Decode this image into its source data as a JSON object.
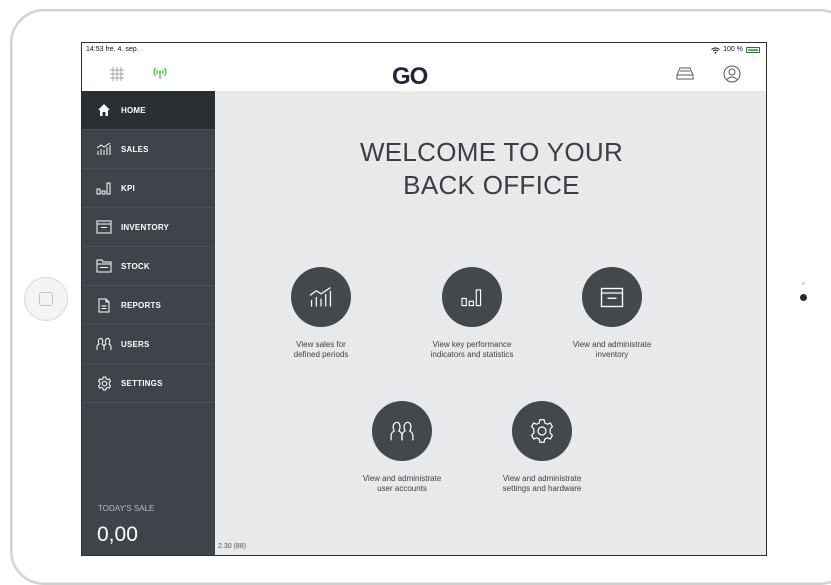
{
  "statusbar": {
    "time": "14:53",
    "date": "fre. 4. sep.",
    "battery": "100 %"
  },
  "header": {
    "logo": "GO"
  },
  "sidebar": {
    "items": [
      {
        "label": "HOME",
        "icon": "home-icon",
        "active": true
      },
      {
        "label": "SALES",
        "icon": "sales-chart-icon",
        "active": false
      },
      {
        "label": "KPI",
        "icon": "kpi-bars-icon",
        "active": false
      },
      {
        "label": "INVENTORY",
        "icon": "inventory-box-icon",
        "active": false
      },
      {
        "label": "STOCK",
        "icon": "stock-folder-icon",
        "active": false
      },
      {
        "label": "REPORTS",
        "icon": "reports-document-icon",
        "active": false
      },
      {
        "label": "USERS",
        "icon": "users-icon",
        "active": false
      },
      {
        "label": "SETTINGS",
        "icon": "settings-gear-icon",
        "active": false
      }
    ],
    "today_label": "TODAY'S SALE",
    "today_value": "0,00"
  },
  "main": {
    "welcome_line1": "WELCOME TO YOUR",
    "welcome_line2": "BACK OFFICE",
    "tiles": [
      {
        "line1": "View sales for",
        "line2": "defined periods",
        "icon": "sales-chart-icon"
      },
      {
        "line1": "View key performance",
        "line2": "indicators and statistics",
        "icon": "kpi-bars-icon"
      },
      {
        "line1": "View and administrate",
        "line2": "inventory",
        "icon": "inventory-box-icon"
      },
      {
        "line1": "View and administrate",
        "line2": "user accounts",
        "icon": "users-icon"
      },
      {
        "line1": "View and administrate",
        "line2": "settings and hardware",
        "icon": "settings-gear-icon"
      }
    ],
    "version": "2.30 (88)"
  },
  "colors": {
    "sidebar": "#3e4449",
    "sidebar_active": "#2b2f33",
    "main_bg": "#e8e9eb",
    "tile_circle": "#43484d",
    "logo": "#23243a",
    "signal": "#3ec33e"
  }
}
